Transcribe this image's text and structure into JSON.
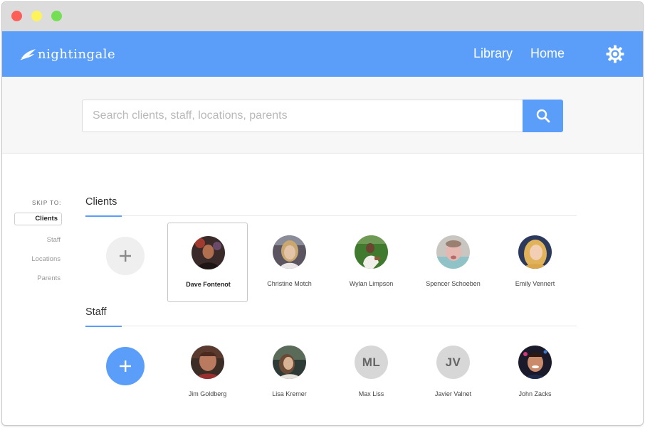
{
  "brand": {
    "name": "nightingale"
  },
  "nav": {
    "library": "Library",
    "home": "Home"
  },
  "search": {
    "placeholder": "Search clients, staff, locations, parents",
    "value": ""
  },
  "skip": {
    "label": "SKIP TO:",
    "items": [
      {
        "label": "Clients",
        "active": true
      },
      {
        "label": "Staff",
        "active": false
      },
      {
        "label": "Locations",
        "active": false
      },
      {
        "label": "Parents",
        "active": false
      }
    ]
  },
  "clients": {
    "title": "Clients",
    "people": [
      {
        "name": "Dave Fontenot",
        "selected": true,
        "avatar_colors": [
          "#3a2a2a",
          "#b07050"
        ]
      },
      {
        "name": "Christine Motch",
        "avatar_colors": [
          "#5a5560",
          "#d9bfa3"
        ]
      },
      {
        "name": "Wylan Limpson",
        "avatar_colors": [
          "#3f7a2e",
          "#e8e6e0"
        ]
      },
      {
        "name": "Spencer Schoeben",
        "avatar_colors": [
          "#c9c6c2",
          "#e6b8b2"
        ]
      },
      {
        "name": "Emily Vennert",
        "avatar_colors": [
          "#2b3a5c",
          "#e8c27a"
        ]
      }
    ]
  },
  "staff": {
    "title": "Staff",
    "people": [
      {
        "name": "Jim Goldberg",
        "avatar_colors": [
          "#3b2c25",
          "#b97a5f"
        ]
      },
      {
        "name": "Lisa Kremer",
        "avatar_colors": [
          "#2e3a36",
          "#b9987a"
        ]
      },
      {
        "name": "Max Liss",
        "initials": "ML"
      },
      {
        "name": "Javier Valnet",
        "initials": "JV"
      },
      {
        "name": "John Zacks",
        "avatar_colors": [
          "#1a1a2a",
          "#c98b6a"
        ]
      }
    ]
  },
  "colors": {
    "accent": "#5b9ef9",
    "titlebar": "#dcdcdc",
    "search_band": "#f7f7f7"
  }
}
